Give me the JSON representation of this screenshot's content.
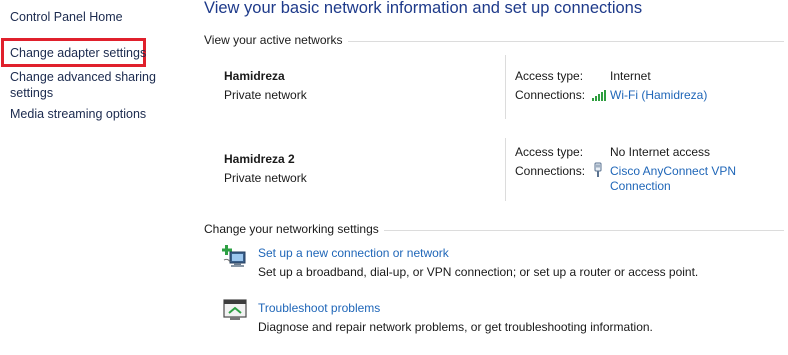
{
  "nav": {
    "home": "Control Panel Home",
    "adapter": "Change adapter settings",
    "sharing": "Change advanced sharing settings",
    "media": "Media streaming options"
  },
  "header": {
    "title": "View your basic network information and set up connections"
  },
  "active_networks": {
    "title": "View your active networks",
    "networks": [
      {
        "name": "Hamidreza",
        "category": "Private network",
        "access_label": "Access type:",
        "access_value": "Internet",
        "connections_label": "Connections:",
        "connection_link": "Wi-Fi (Hamidreza)",
        "connection_icon": "wifi-signal-icon"
      },
      {
        "name": "Hamidreza 2",
        "category": "Private network",
        "access_label": "Access type:",
        "access_value": "No Internet access",
        "connections_label": "Connections:",
        "connection_link_line1": "Cisco AnyConnect VPN",
        "connection_link_line2": "Connection",
        "connection_icon": "ethernet-plug-icon"
      }
    ]
  },
  "settings": {
    "title": "Change your networking settings",
    "items": [
      {
        "link": "Set up a new connection or network",
        "desc": "Set up a broadband, dial-up, or VPN connection; or set up a router or access point.",
        "icon": "new-connection-icon"
      },
      {
        "link": "Troubleshoot problems",
        "desc": "Diagnose and repair network problems, or get troubleshooting information.",
        "icon": "troubleshoot-icon"
      }
    ]
  },
  "colors": {
    "link": "#1f66b8",
    "title": "#1e3a8a",
    "highlight": "#e0202c"
  }
}
